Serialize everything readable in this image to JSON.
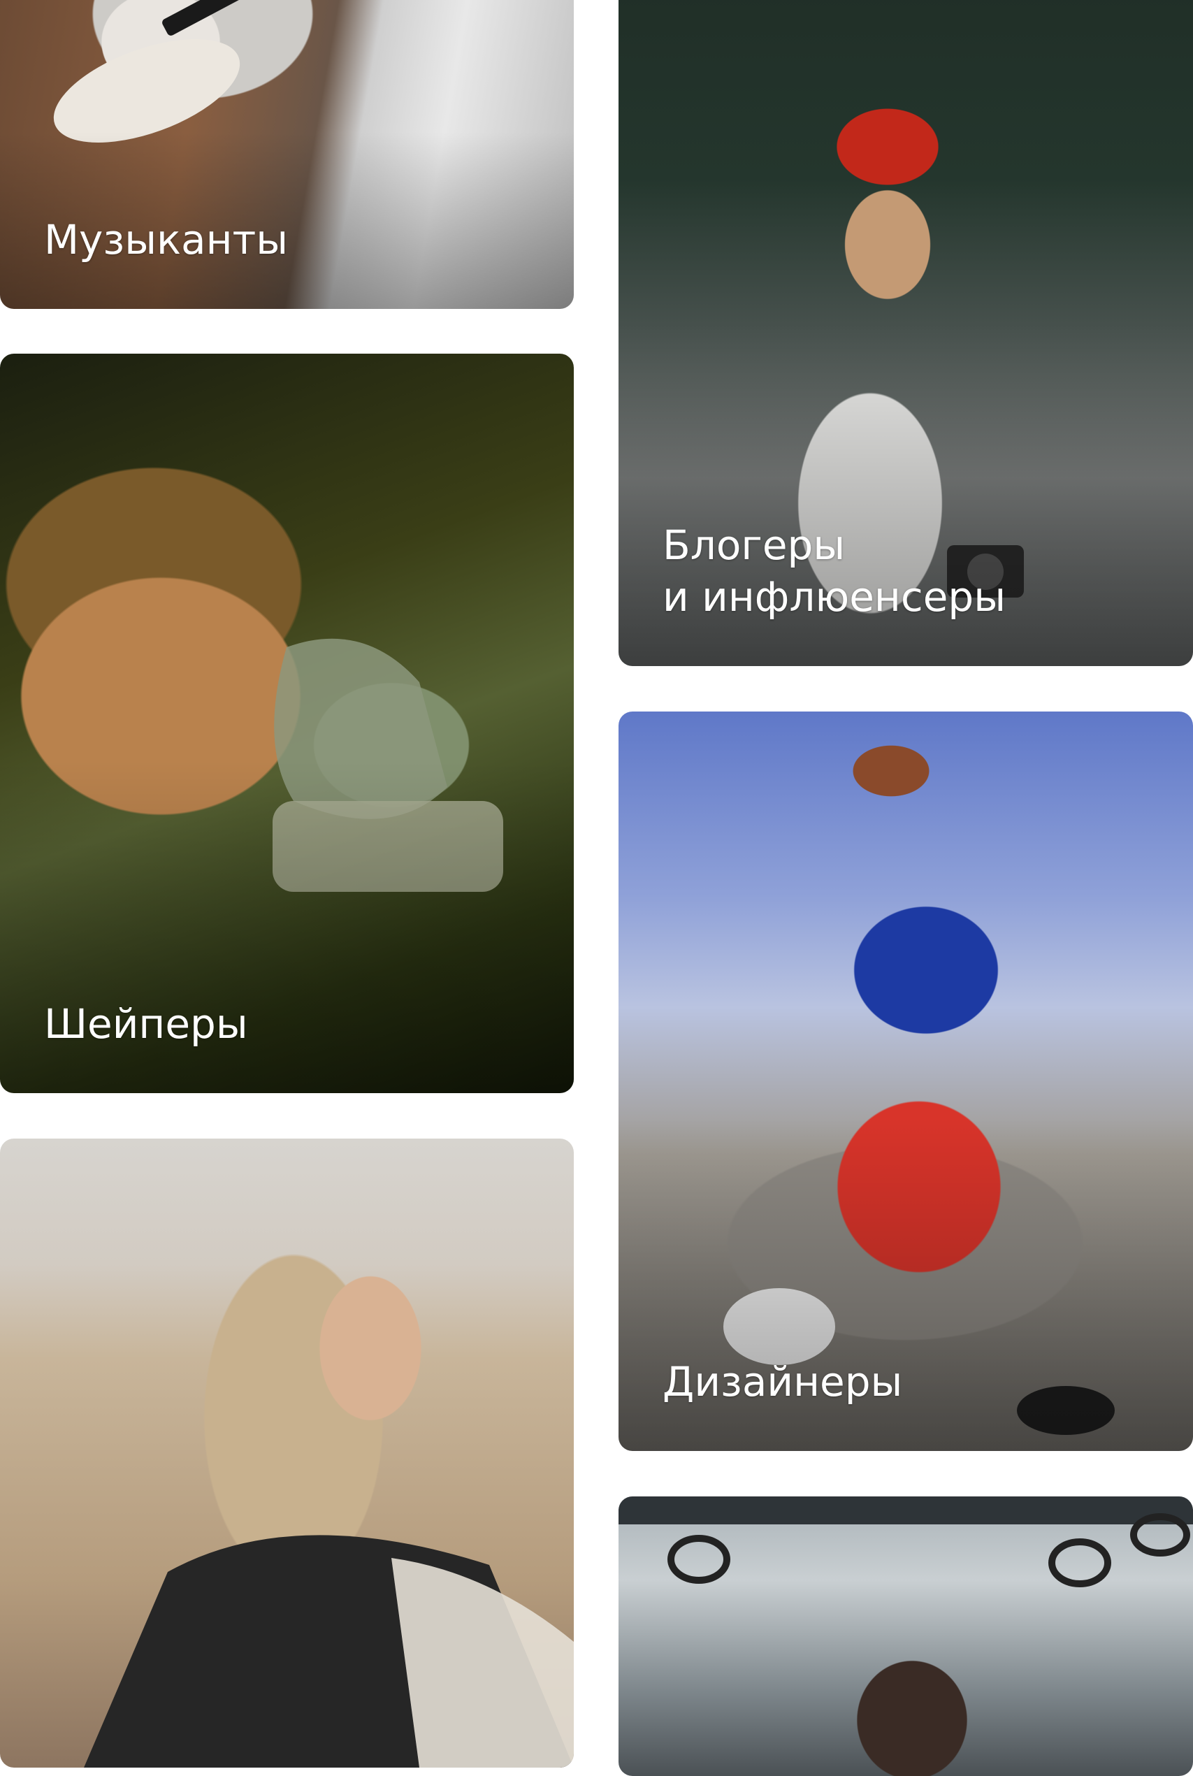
{
  "cards": [
    {
      "id": "musicians",
      "label": "Музыканты",
      "photo": "musician-with-guitar-photo"
    },
    {
      "id": "shapers",
      "label": "Шейперы",
      "photo": "shaper-in-respirator-photo"
    },
    {
      "id": "surfer",
      "label": "",
      "photo": "woman-on-beach-photo"
    },
    {
      "id": "bloggers",
      "label": "Блогеры\nи инфлюенсеры",
      "photo": "woman-with-camera-photo"
    },
    {
      "id": "designers",
      "label": "Дизайнеры",
      "photo": "man-sitting-on-rocks-photo"
    },
    {
      "id": "bus",
      "label": "",
      "photo": "woman-in-bus-photo"
    }
  ]
}
